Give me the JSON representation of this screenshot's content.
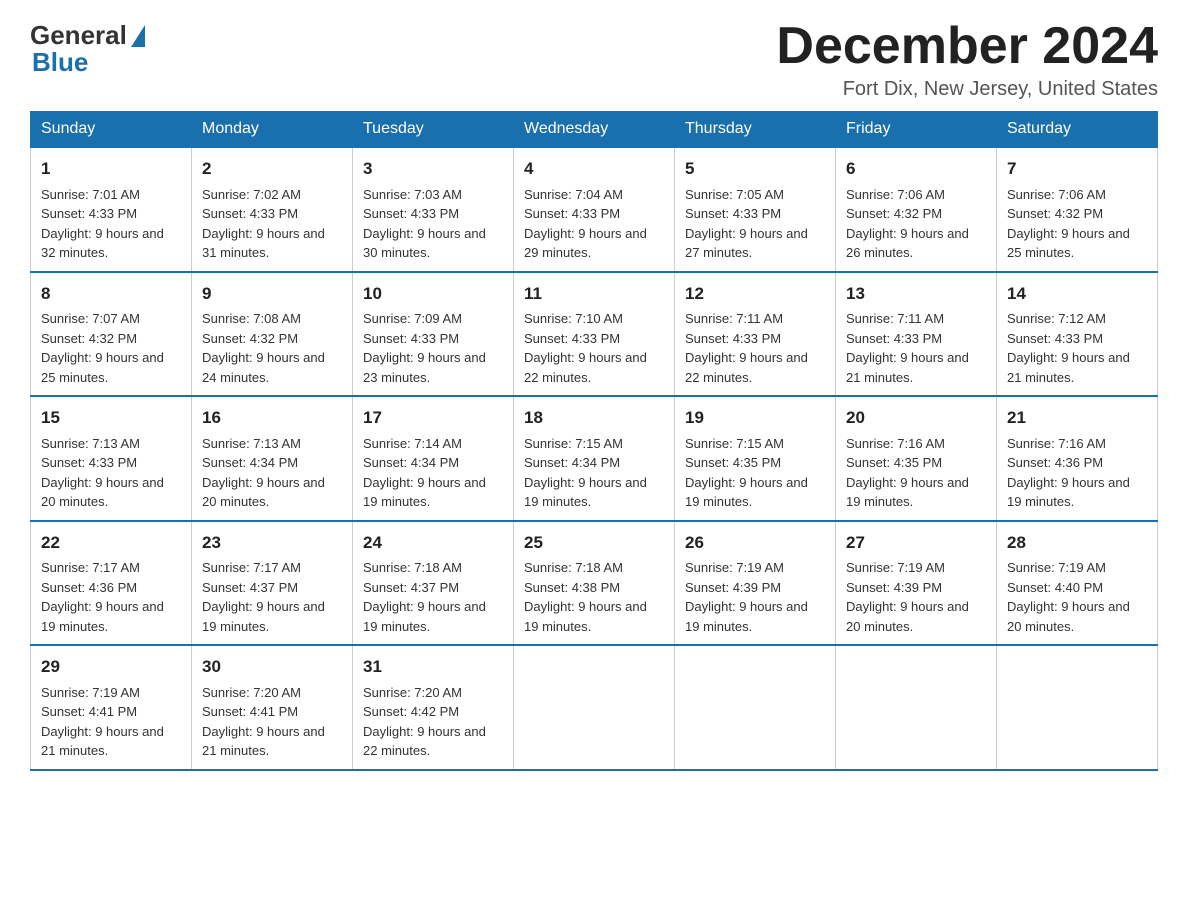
{
  "header": {
    "logo_general": "General",
    "logo_blue": "Blue",
    "month_title": "December 2024",
    "location": "Fort Dix, New Jersey, United States"
  },
  "days_of_week": [
    "Sunday",
    "Monday",
    "Tuesday",
    "Wednesday",
    "Thursday",
    "Friday",
    "Saturday"
  ],
  "weeks": [
    [
      {
        "day": "1",
        "sunrise": "Sunrise: 7:01 AM",
        "sunset": "Sunset: 4:33 PM",
        "daylight": "Daylight: 9 hours and 32 minutes."
      },
      {
        "day": "2",
        "sunrise": "Sunrise: 7:02 AM",
        "sunset": "Sunset: 4:33 PM",
        "daylight": "Daylight: 9 hours and 31 minutes."
      },
      {
        "day": "3",
        "sunrise": "Sunrise: 7:03 AM",
        "sunset": "Sunset: 4:33 PM",
        "daylight": "Daylight: 9 hours and 30 minutes."
      },
      {
        "day": "4",
        "sunrise": "Sunrise: 7:04 AM",
        "sunset": "Sunset: 4:33 PM",
        "daylight": "Daylight: 9 hours and 29 minutes."
      },
      {
        "day": "5",
        "sunrise": "Sunrise: 7:05 AM",
        "sunset": "Sunset: 4:33 PM",
        "daylight": "Daylight: 9 hours and 27 minutes."
      },
      {
        "day": "6",
        "sunrise": "Sunrise: 7:06 AM",
        "sunset": "Sunset: 4:32 PM",
        "daylight": "Daylight: 9 hours and 26 minutes."
      },
      {
        "day": "7",
        "sunrise": "Sunrise: 7:06 AM",
        "sunset": "Sunset: 4:32 PM",
        "daylight": "Daylight: 9 hours and 25 minutes."
      }
    ],
    [
      {
        "day": "8",
        "sunrise": "Sunrise: 7:07 AM",
        "sunset": "Sunset: 4:32 PM",
        "daylight": "Daylight: 9 hours and 25 minutes."
      },
      {
        "day": "9",
        "sunrise": "Sunrise: 7:08 AM",
        "sunset": "Sunset: 4:32 PM",
        "daylight": "Daylight: 9 hours and 24 minutes."
      },
      {
        "day": "10",
        "sunrise": "Sunrise: 7:09 AM",
        "sunset": "Sunset: 4:33 PM",
        "daylight": "Daylight: 9 hours and 23 minutes."
      },
      {
        "day": "11",
        "sunrise": "Sunrise: 7:10 AM",
        "sunset": "Sunset: 4:33 PM",
        "daylight": "Daylight: 9 hours and 22 minutes."
      },
      {
        "day": "12",
        "sunrise": "Sunrise: 7:11 AM",
        "sunset": "Sunset: 4:33 PM",
        "daylight": "Daylight: 9 hours and 22 minutes."
      },
      {
        "day": "13",
        "sunrise": "Sunrise: 7:11 AM",
        "sunset": "Sunset: 4:33 PM",
        "daylight": "Daylight: 9 hours and 21 minutes."
      },
      {
        "day": "14",
        "sunrise": "Sunrise: 7:12 AM",
        "sunset": "Sunset: 4:33 PM",
        "daylight": "Daylight: 9 hours and 21 minutes."
      }
    ],
    [
      {
        "day": "15",
        "sunrise": "Sunrise: 7:13 AM",
        "sunset": "Sunset: 4:33 PM",
        "daylight": "Daylight: 9 hours and 20 minutes."
      },
      {
        "day": "16",
        "sunrise": "Sunrise: 7:13 AM",
        "sunset": "Sunset: 4:34 PM",
        "daylight": "Daylight: 9 hours and 20 minutes."
      },
      {
        "day": "17",
        "sunrise": "Sunrise: 7:14 AM",
        "sunset": "Sunset: 4:34 PM",
        "daylight": "Daylight: 9 hours and 19 minutes."
      },
      {
        "day": "18",
        "sunrise": "Sunrise: 7:15 AM",
        "sunset": "Sunset: 4:34 PM",
        "daylight": "Daylight: 9 hours and 19 minutes."
      },
      {
        "day": "19",
        "sunrise": "Sunrise: 7:15 AM",
        "sunset": "Sunset: 4:35 PM",
        "daylight": "Daylight: 9 hours and 19 minutes."
      },
      {
        "day": "20",
        "sunrise": "Sunrise: 7:16 AM",
        "sunset": "Sunset: 4:35 PM",
        "daylight": "Daylight: 9 hours and 19 minutes."
      },
      {
        "day": "21",
        "sunrise": "Sunrise: 7:16 AM",
        "sunset": "Sunset: 4:36 PM",
        "daylight": "Daylight: 9 hours and 19 minutes."
      }
    ],
    [
      {
        "day": "22",
        "sunrise": "Sunrise: 7:17 AM",
        "sunset": "Sunset: 4:36 PM",
        "daylight": "Daylight: 9 hours and 19 minutes."
      },
      {
        "day": "23",
        "sunrise": "Sunrise: 7:17 AM",
        "sunset": "Sunset: 4:37 PM",
        "daylight": "Daylight: 9 hours and 19 minutes."
      },
      {
        "day": "24",
        "sunrise": "Sunrise: 7:18 AM",
        "sunset": "Sunset: 4:37 PM",
        "daylight": "Daylight: 9 hours and 19 minutes."
      },
      {
        "day": "25",
        "sunrise": "Sunrise: 7:18 AM",
        "sunset": "Sunset: 4:38 PM",
        "daylight": "Daylight: 9 hours and 19 minutes."
      },
      {
        "day": "26",
        "sunrise": "Sunrise: 7:19 AM",
        "sunset": "Sunset: 4:39 PM",
        "daylight": "Daylight: 9 hours and 19 minutes."
      },
      {
        "day": "27",
        "sunrise": "Sunrise: 7:19 AM",
        "sunset": "Sunset: 4:39 PM",
        "daylight": "Daylight: 9 hours and 20 minutes."
      },
      {
        "day": "28",
        "sunrise": "Sunrise: 7:19 AM",
        "sunset": "Sunset: 4:40 PM",
        "daylight": "Daylight: 9 hours and 20 minutes."
      }
    ],
    [
      {
        "day": "29",
        "sunrise": "Sunrise: 7:19 AM",
        "sunset": "Sunset: 4:41 PM",
        "daylight": "Daylight: 9 hours and 21 minutes."
      },
      {
        "day": "30",
        "sunrise": "Sunrise: 7:20 AM",
        "sunset": "Sunset: 4:41 PM",
        "daylight": "Daylight: 9 hours and 21 minutes."
      },
      {
        "day": "31",
        "sunrise": "Sunrise: 7:20 AM",
        "sunset": "Sunset: 4:42 PM",
        "daylight": "Daylight: 9 hours and 22 minutes."
      },
      {
        "day": "",
        "sunrise": "",
        "sunset": "",
        "daylight": ""
      },
      {
        "day": "",
        "sunrise": "",
        "sunset": "",
        "daylight": ""
      },
      {
        "day": "",
        "sunrise": "",
        "sunset": "",
        "daylight": ""
      },
      {
        "day": "",
        "sunrise": "",
        "sunset": "",
        "daylight": ""
      }
    ]
  ]
}
